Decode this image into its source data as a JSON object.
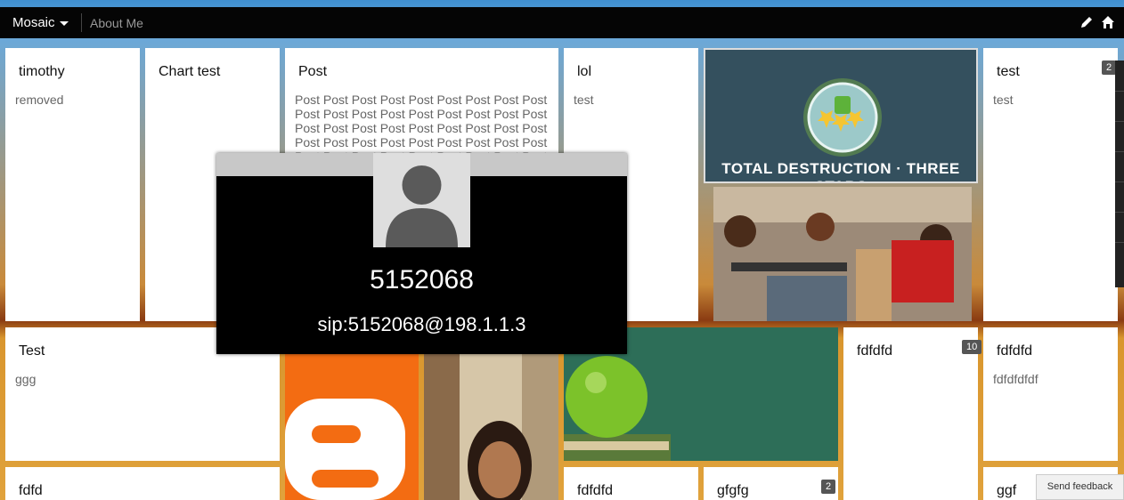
{
  "topbar": {
    "brand": "Mosaic",
    "about": "About Me",
    "icons": [
      "pencil-icon",
      "home-icon"
    ]
  },
  "tiles": {
    "timothy": {
      "title": "timothy",
      "body": "removed"
    },
    "chart": {
      "title": "Chart test"
    },
    "post": {
      "title": "Post",
      "body": "Post Post Post Post Post Post Post Post Post Post Post Post Post Post Post Post Post Post Post Post Post Post Post Post Post Post Post Post Post Post Post Post Post Post Post Post Post Post Post Post Post Post Post Post Post"
    },
    "lol": {
      "title": "lol",
      "body": "test"
    },
    "game_banner": {
      "caption": "TOTAL DESTRUCTION · THREE STARS"
    },
    "test_top": {
      "title": "test",
      "body": "test",
      "badge": "2"
    },
    "test_mid": {
      "title": "Test",
      "body": "ggg"
    },
    "fdfdfd1": {
      "title": "fdfdfd",
      "badge": "10"
    },
    "fdfdfd2": {
      "title": "fdfdfd",
      "body": "fdfdfdfdf"
    },
    "fdfd": {
      "title": "fdfd"
    },
    "fdfdfd3": {
      "title": "fdfdfd"
    },
    "gfgfg": {
      "title": "gfgfg",
      "badge": "2"
    },
    "ggf": {
      "title": "ggf"
    }
  },
  "popup": {
    "number": "5152068",
    "sip": "sip:5152068@198.1.1.3"
  },
  "feedback": {
    "label": "Send feedback"
  },
  "colors": {
    "topbar": "#050505",
    "badge": "#555555"
  }
}
